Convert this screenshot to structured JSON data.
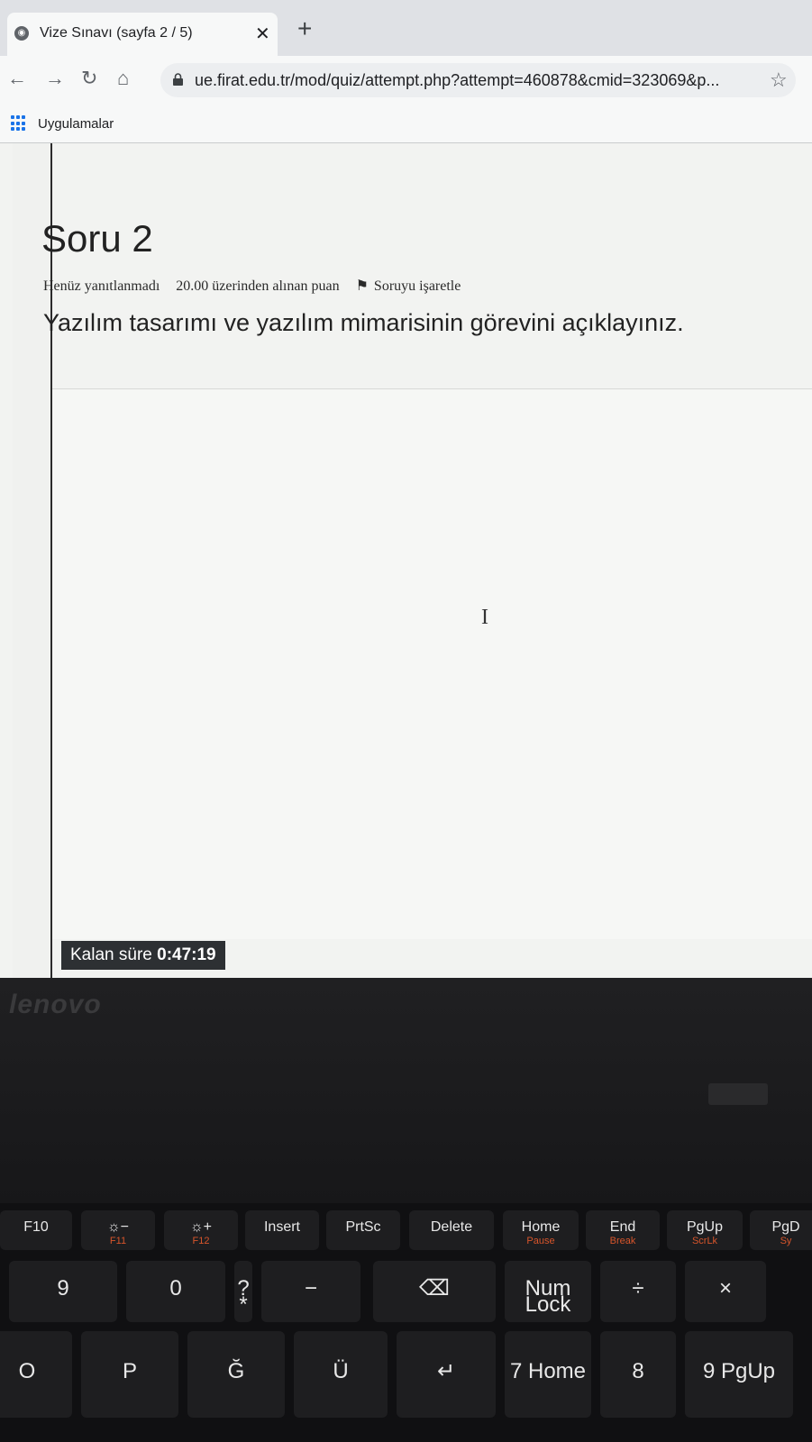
{
  "browser": {
    "tab_title": "Vize Sınavı (sayfa 2 / 5)",
    "url": "ue.firat.edu.tr/mod/quiz/attempt.php?attempt=460878&cmid=323069&p...",
    "bookmark_apps_label": "Uygulamalar"
  },
  "quiz": {
    "question_title": "Soru 2",
    "status": "Henüz yanıtlanmadı",
    "points": "20.00 üzerinden alınan puan",
    "flag_label": "Soruyu işaretle",
    "question_text": "Yazılım tasarımı ve yazılım mimarisinin görevini açıklayınız.",
    "timer_label": "Kalan süre",
    "timer_value": "0:47:19"
  },
  "laptop": {
    "brand": "lenovo"
  },
  "keyboard": {
    "row1": [
      {
        "name": "key-f10",
        "label": "F10",
        "sub": ""
      },
      {
        "name": "key-f11",
        "label": "☼−",
        "sub": "F11"
      },
      {
        "name": "key-f12",
        "label": "☼+",
        "sub": "F12"
      },
      {
        "name": "key-insert",
        "label": "Insert",
        "sub": ""
      },
      {
        "name": "key-prtsc",
        "label": "PrtSc",
        "sub": ""
      },
      {
        "name": "key-delete",
        "label": "Delete",
        "sub": ""
      },
      {
        "name": "key-home",
        "label": "Home",
        "sub": "Pause"
      },
      {
        "name": "key-end",
        "label": "End",
        "sub": "Break"
      },
      {
        "name": "key-pgup",
        "label": "PgUp",
        "sub": "ScrLk"
      },
      {
        "name": "key-pgdn",
        "label": "PgD",
        "sub": "Sy"
      }
    ],
    "row2": [
      {
        "name": "key-9",
        "label": "9"
      },
      {
        "name": "key-0",
        "label": "0"
      },
      {
        "name": "key-star",
        "label": "? *"
      },
      {
        "name": "key-minus",
        "label": "−"
      },
      {
        "name": "key-backspace",
        "label": "⌫"
      },
      {
        "name": "key-numlock",
        "label": "Num Lock"
      },
      {
        "name": "key-divide",
        "label": "÷"
      },
      {
        "name": "key-multiply",
        "label": "×"
      }
    ],
    "row3": [
      {
        "name": "key-o",
        "label": "O"
      },
      {
        "name": "key-p",
        "label": "P"
      },
      {
        "name": "key-g-breve",
        "label": "Ğ"
      },
      {
        "name": "key-u-umlaut",
        "label": "Ü"
      },
      {
        "name": "key-enter",
        "label": "↵"
      },
      {
        "name": "key-7",
        "label": "7 Home"
      },
      {
        "name": "key-8",
        "label": "8"
      },
      {
        "name": "key-9-numpad",
        "label": "9 PgUp"
      }
    ]
  }
}
